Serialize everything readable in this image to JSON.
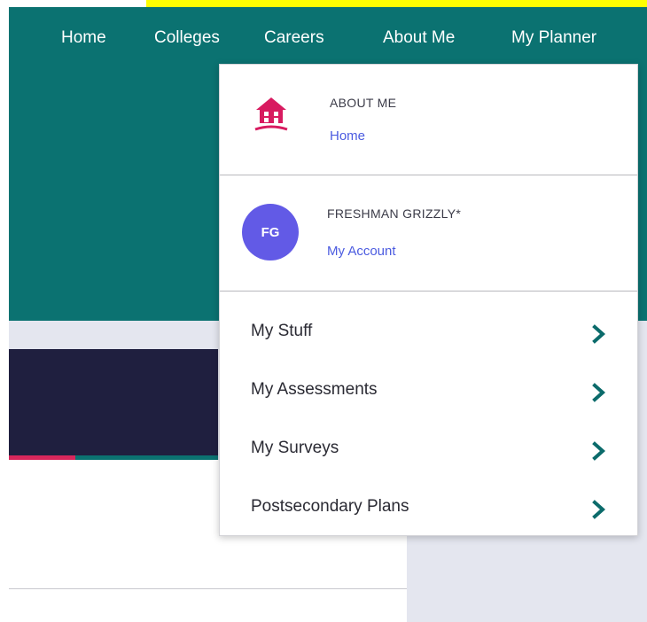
{
  "nav": {
    "items": [
      {
        "label": "Home"
      },
      {
        "label": "Colleges"
      },
      {
        "label": "Careers"
      },
      {
        "label": "About Me"
      },
      {
        "label": "My Planner"
      }
    ]
  },
  "dropdown": {
    "about_section": {
      "title": "ABOUT ME",
      "link": "Home",
      "icon": "house-icon"
    },
    "account_section": {
      "avatar_initials": "FG",
      "name": "FRESHMAN GRIZZLY*",
      "link": "My Account"
    },
    "menu_items": [
      {
        "label": "My Stuff"
      },
      {
        "label": "My Assessments"
      },
      {
        "label": "My Surveys"
      },
      {
        "label": "Postsecondary Plans"
      }
    ]
  },
  "colors": {
    "header_teal": "#0b7271",
    "accent_pink": "#d8275c",
    "avatar_purple": "#625ae6",
    "link_blue": "#4b5be0",
    "highlight_yellow": "#ffff00",
    "banner_navy": "#1f1f3f"
  }
}
